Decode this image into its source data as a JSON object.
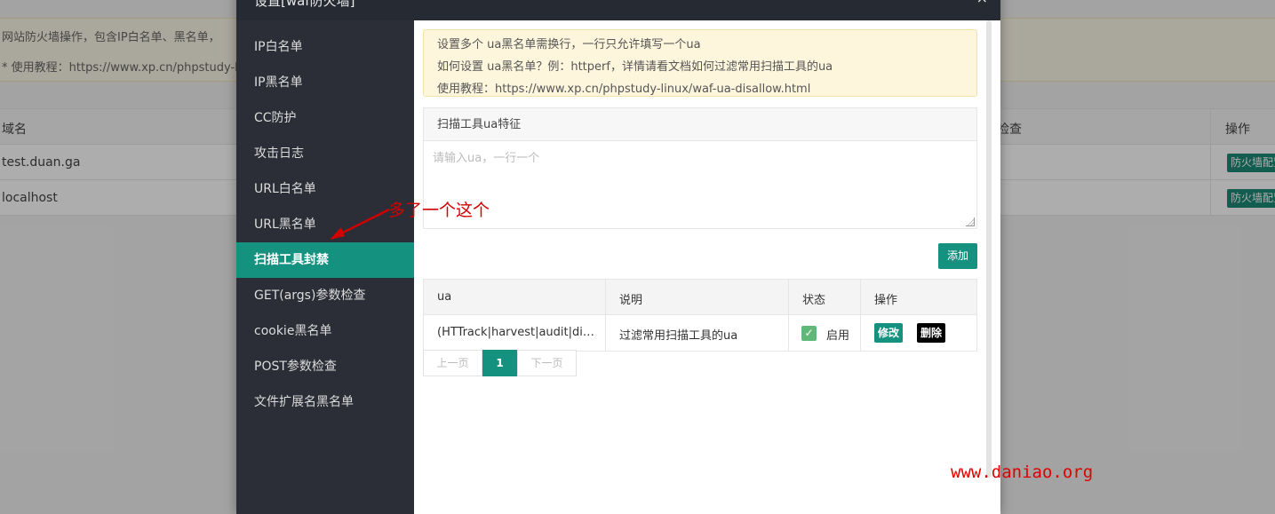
{
  "background": {
    "notice_line1": "网站防火墙操作，包含IP白名单、黑名单，",
    "notice_line2": "* 使用教程：https://www.xp.cn/phpstudy-lin",
    "table": {
      "headers": {
        "domain": "域名",
        "check": "检查",
        "op": "操作"
      },
      "rows": [
        {
          "domain": "test.duan.ga",
          "op": "防火墙配置"
        },
        {
          "domain": "localhost",
          "op": "防火墙配置"
        }
      ]
    }
  },
  "modal": {
    "title": "设置[waf防火墙]",
    "close": "×",
    "nav": [
      "IP白名单",
      "IP黑名单",
      "CC防护",
      "攻击日志",
      "URL白名单",
      "URL黑名单",
      "扫描工具封禁",
      "GET(args)参数检查",
      "cookie黑名单",
      "POST参数检查",
      "文件扩展名黑名单"
    ],
    "active_nav": "扫描工具封禁",
    "tips": {
      "line1": "设置多个 ua黑名单需换行，一行只允许填写一个ua",
      "line2": "如何设置 ua黑名单？例：httperf，详情请看文档如何过滤常用扫描工具的ua",
      "line3": "使用教程：https://www.xp.cn/phpstudy-linux/waf-ua-disallow.html"
    },
    "form": {
      "label": "扫描工具ua特征",
      "placeholder": "请输入ua，一行一个",
      "value": ""
    },
    "add_button": "添加",
    "table": {
      "headers": [
        "ua",
        "说明",
        "状态",
        "操作"
      ],
      "rows": [
        {
          "ua": "(HTTrack|harvest|audit|di…",
          "desc": "过滤常用扫描工具的ua",
          "status": "启用",
          "enabled": true,
          "edit": "修改",
          "delete": "删除"
        }
      ]
    },
    "pager": {
      "prev": "上一页",
      "current": "1",
      "next": "下一页"
    }
  },
  "annotation": "多了一个这个",
  "watermark": "www.daniao.org",
  "colors": {
    "accent": "#14917f",
    "sidebar": "#2b2e36",
    "header": "#262a33",
    "annotation": "#d20000"
  }
}
